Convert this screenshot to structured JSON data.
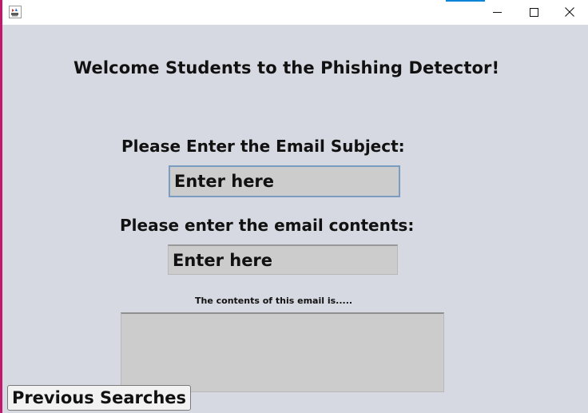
{
  "window": {
    "title": "",
    "icon": "java-coffee-cup-icon",
    "controls": [
      "minimize-icon",
      "maximize-icon",
      "close-icon"
    ],
    "accent_color": "#0a84d6"
  },
  "main": {
    "heading": "Welcome Students to the Phishing Detector!",
    "subject_label": "Please Enter the Email Subject:",
    "subject_value": "Enter here",
    "contents_label": "Please enter the email contents:",
    "contents_value": "Enter here",
    "result_label": "The contents of this email is.....",
    "result_text": "",
    "previous_searches_button": "Previous Searches"
  },
  "colors": {
    "background": "#d6d9e1",
    "field_background": "#cccccc",
    "focused_border": "#7a9cc0"
  }
}
